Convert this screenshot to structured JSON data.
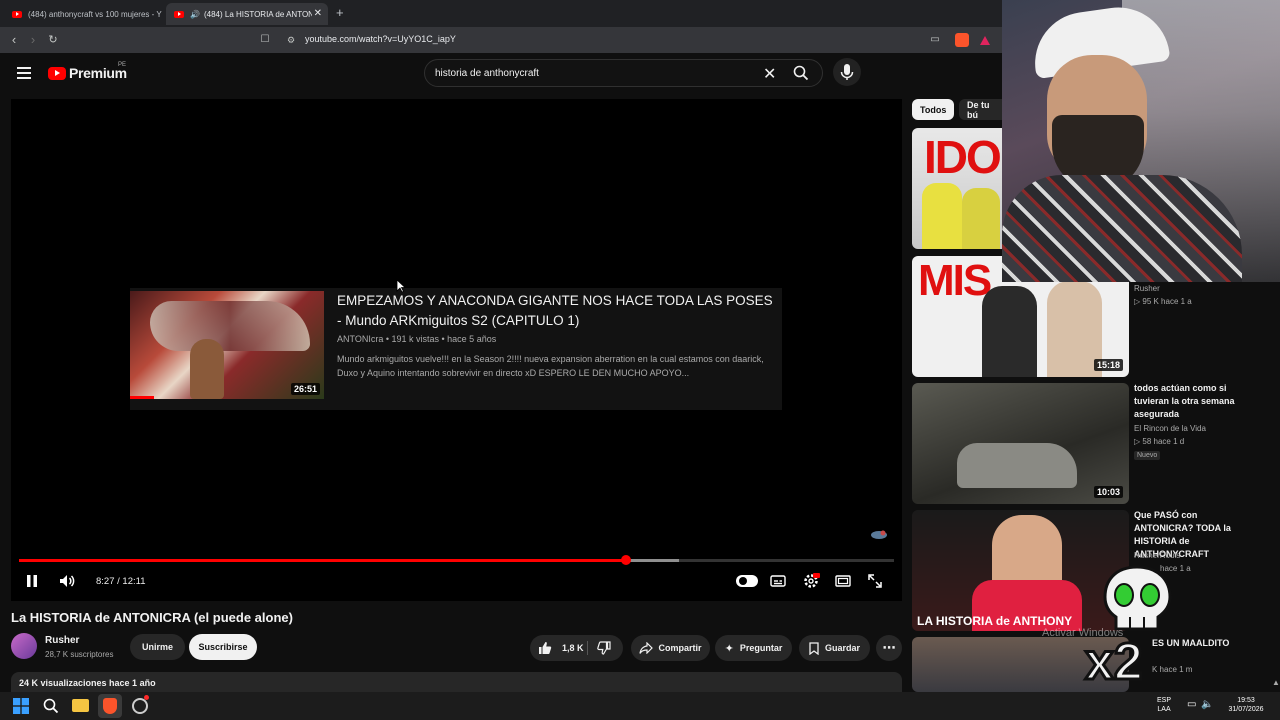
{
  "browser": {
    "tabs": [
      {
        "label": "(484) anthonycraft vs 100 mujeres - Y"
      },
      {
        "label": "(484) La HISTORIA de ANTON"
      }
    ],
    "url": "youtube.com/watch?v=UyYO1C_iapY"
  },
  "header": {
    "brand": "Premium",
    "region": "PE",
    "search_query": "historia de anthonycraft"
  },
  "player": {
    "endscreen": {
      "title": "EMPEZAMOS Y ANACONDA GIGANTE NOS HACE TODA LAS POSES - Mundo ARKmiguitos S2 (CAPITULO 1)",
      "channel_meta": "ANTONIcra • 191 k vistas • hace 5 años",
      "description": "Mundo arkmiguitos vuelve!!! en la Season 2!!!! nueva expansion aberration en la cual estamos con daarick, Duxo y Aquino intentando sobrevivir en directo xD ESPERO LE DEN MUCHO APOYO...",
      "duration": "26:51"
    },
    "time": "8:27 / 12:11",
    "progress_fraction": 0.694,
    "buffered_fraction": 0.754
  },
  "video": {
    "title": "La HISTORIA de ANTONICRA (el puede alone)",
    "channel": "Rusher",
    "subscribers": "28,7 K suscriptores",
    "join_label": "Unirme",
    "subscribe_label": "Suscribirse",
    "likes": "1,8 K",
    "share_label": "Compartir",
    "ask_label": "Preguntar",
    "save_label": "Guardar",
    "views_date": "24 K visualizaciones  hace 1 año"
  },
  "sidebar": {
    "chips": [
      "Todos",
      "De tu bú"
    ],
    "items": [
      {
        "title": "",
        "channel": "",
        "meta": "",
        "duration": ""
      },
      {
        "title": "",
        "channel": "Rusher",
        "meta": "▷ 95 K  hace 1 a",
        "duration": "15:18"
      },
      {
        "title": "todos actúan como si tuvieran la otra semana asegurada",
        "channel": "El Rincon de la Vida",
        "meta": "▷ 58  hace 1 d",
        "badge": "Nuevo",
        "duration": "10:03"
      },
      {
        "title": "Que PASÓ con ANTONICRA? TODA la HISTORIA de ANTHONYCRAFT",
        "channel": "RusherRouls",
        "meta": "hace 1 a",
        "thumb_text": "LA HISTORIA de ANTHONY",
        "duration": ""
      },
      {
        "title": "ES UN MAALDITO",
        "channel": "",
        "meta": "K  hace 1 m",
        "duration": ""
      }
    ]
  },
  "overlay": {
    "thumb1_text": "IDO",
    "thumb2_text": "MIS",
    "multiplier": "x2",
    "activate_windows": "Activar Windows"
  },
  "taskbar": {
    "lang": "ESP",
    "lang2": "LAA",
    "time": "19:53",
    "date": "31/07/2026"
  },
  "colors": {
    "accent": "#ff0000",
    "background": "#0f0f0f"
  }
}
